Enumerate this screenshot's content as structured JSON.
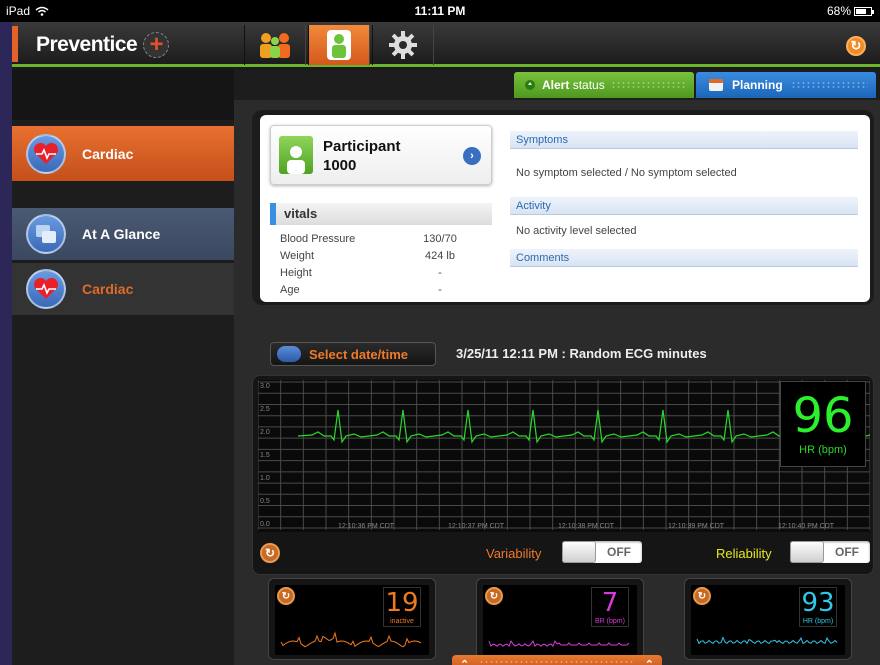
{
  "status_bar": {
    "device": "iPad",
    "time": "11:11 PM",
    "battery": "68%"
  },
  "app": {
    "logo_text": "Preventice",
    "logo_plus": "+"
  },
  "sidebar": {
    "items": [
      {
        "label": "Cardiac"
      },
      {
        "label": "At A Glance"
      },
      {
        "label": "Cardiac"
      }
    ]
  },
  "tabs": {
    "alert": {
      "bold": "Alert",
      "rest": "status"
    },
    "planning": "Planning"
  },
  "participant": {
    "line1": "Participant",
    "line2": "1000"
  },
  "vitals": {
    "title": "vitals",
    "rows": [
      {
        "label": "Blood Pressure",
        "value": "130/70"
      },
      {
        "label": "Weight",
        "value": "424 lb"
      },
      {
        "label": "Height",
        "value": "-"
      },
      {
        "label": "Age",
        "value": "-"
      }
    ]
  },
  "sections": {
    "symptoms": {
      "title": "Symptoms",
      "text": "No symptom selected / No symptom selected"
    },
    "activity": {
      "title": "Activity",
      "text": "No activity level selected"
    },
    "comments": {
      "title": "Comments"
    }
  },
  "date_button": "Select date/time",
  "recording_title": "3/25/11 12:11 PM : Random ECG minutes",
  "ecg": {
    "y_ticks": [
      "3.0",
      "2.5",
      "2.0",
      "1.5",
      "1.0",
      "0.5",
      "0.0"
    ],
    "x_ticks": [
      "12:10:36 PM CDT",
      "12:10:37 PM CDT",
      "12:10:38 PM CDT",
      "12:10:39 PM CDT",
      "12:10:40 PM CDT"
    ],
    "hr_value": "96",
    "hr_label": "HR (bpm)",
    "line_color": "#2bd82b"
  },
  "controls": {
    "variability": {
      "label": "Variability",
      "state": "OFF"
    },
    "reliability": {
      "label": "Reliability",
      "state": "OFF"
    }
  },
  "minis": [
    {
      "value": "19",
      "unit": "inactive",
      "color": "#f07a1e"
    },
    {
      "value": "7",
      "unit": "BR (bpm)",
      "color": "#d83ad8"
    },
    {
      "value": "93",
      "unit": "HR (bpm)",
      "color": "#30c8e8"
    }
  ],
  "icons": [
    "wifi-icon",
    "battery-icon",
    "group-icon",
    "person-icon",
    "gear-icon",
    "refresh-icon",
    "heart-icon",
    "glance-icon",
    "clock-icon",
    "chevron-right-icon",
    "chevron-up-icon"
  ]
}
